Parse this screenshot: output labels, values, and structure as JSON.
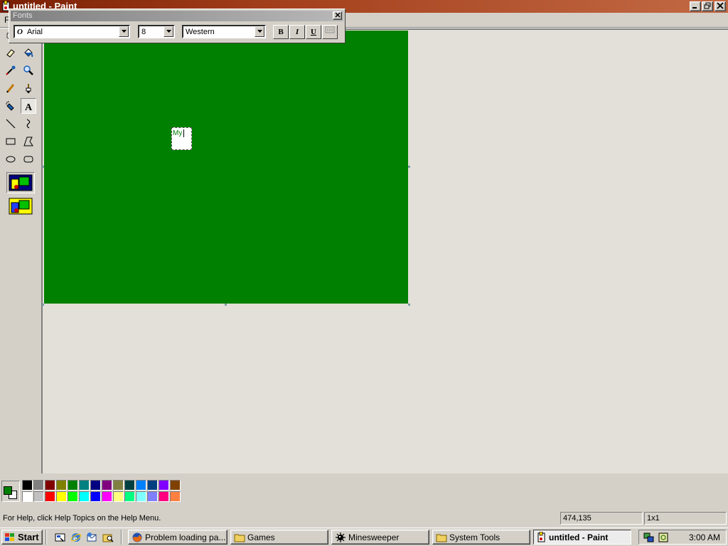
{
  "window": {
    "title": "untitled - Paint",
    "buttons": [
      "minimize",
      "restore",
      "close"
    ]
  },
  "menubar": {
    "file_label": "F"
  },
  "fonts_toolbar": {
    "title": "Fonts",
    "font_name": "Arial",
    "font_size": "8",
    "script": "Western",
    "bold_label": "B",
    "italic_label": "I",
    "underline_label": "U"
  },
  "canvas": {
    "background_color": "#008000",
    "text_entry": "My"
  },
  "toolbox": {
    "tools": [
      "free-form-select",
      "select",
      "eraser",
      "fill-with-color",
      "pick-color",
      "magnifier",
      "pencil",
      "brush",
      "airbrush",
      "text",
      "line",
      "curve",
      "rectangle",
      "polygon",
      "ellipse",
      "rounded-rectangle"
    ],
    "active_tool": "text",
    "options": [
      "opaque-background",
      "transparent-background"
    ]
  },
  "palette": {
    "foreground": "#008000",
    "background": "#ffffff",
    "colors_row1": [
      "#000000",
      "#808080",
      "#800000",
      "#808000",
      "#008000",
      "#008080",
      "#000080",
      "#800080",
      "#808040",
      "#004040",
      "#0080ff",
      "#004080",
      "#8000ff",
      "#804000"
    ],
    "colors_row2": [
      "#ffffff",
      "#c0c0c0",
      "#ff0000",
      "#ffff00",
      "#00ff00",
      "#00ffff",
      "#0000ff",
      "#ff00ff",
      "#ffff80",
      "#00ff80",
      "#80ffff",
      "#8080ff",
      "#ff0080",
      "#ff8040"
    ]
  },
  "statusbar": {
    "help_text": "For Help, click Help Topics on the Help Menu.",
    "coordinates": "474,135",
    "size": "1x1"
  },
  "taskbar": {
    "start_label": "Start",
    "quick_launch": [
      "show-desktop",
      "internet-explorer",
      "outlook-express",
      "windows-explorer"
    ],
    "buttons": [
      {
        "label": "Problem loading pa...",
        "icon": "firefox-icon"
      },
      {
        "label": "Games",
        "icon": "folder-icon"
      },
      {
        "label": "Minesweeper",
        "icon": "mine-icon"
      },
      {
        "label": "System Tools",
        "icon": "folder-icon"
      },
      {
        "label": "untitled - Paint",
        "icon": "paint-icon",
        "active": true
      }
    ],
    "clock": "3:00 AM"
  }
}
